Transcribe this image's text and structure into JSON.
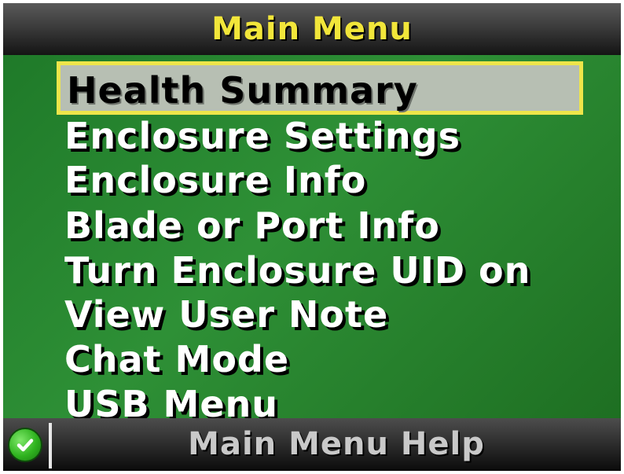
{
  "header": {
    "title": "Main Menu"
  },
  "menu": {
    "items": [
      {
        "label": "Health Summary",
        "selected": true
      },
      {
        "label": "Enclosure Settings"
      },
      {
        "label": "Enclosure Info"
      },
      {
        "label": "Blade or Port Info"
      },
      {
        "label": "Turn Enclosure UID on"
      },
      {
        "label": "View User Note"
      },
      {
        "label": "Chat Mode"
      },
      {
        "label": "USB Menu"
      }
    ]
  },
  "footer": {
    "help_label": "Main Menu Help",
    "status_icon": "check-circle-icon"
  },
  "colors": {
    "title": "#f2e63a",
    "menu_background": "#2e9036",
    "selection_border": "#eee54a",
    "selection_fill": "#b7bfb3",
    "help_text": "#c9c9c9"
  }
}
